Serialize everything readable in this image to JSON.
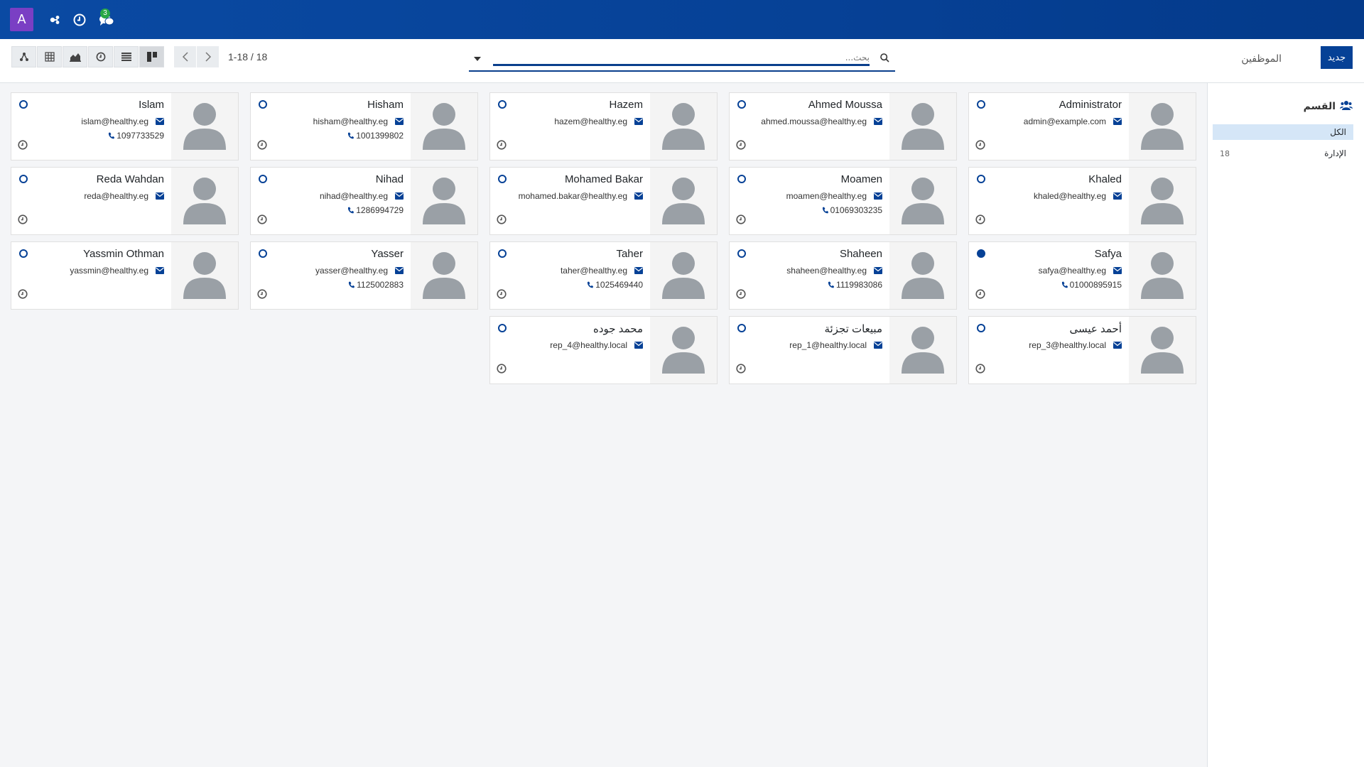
{
  "navbar": {
    "avatar_letter": "A",
    "message_count": "3"
  },
  "control_panel": {
    "breadcrumb": "الموظفين",
    "new_button": "جديد",
    "search_placeholder": "بحث...",
    "pager_value": "1-18 / 18",
    "view_icons": [
      "hierarchy-icon",
      "pivot-icon",
      "graph-icon",
      "activity-icon",
      "list-icon",
      "kanban-icon"
    ]
  },
  "side_panel": {
    "header": "القسم",
    "items": [
      {
        "label": "الكل",
        "count": "",
        "active": true
      },
      {
        "label": "الإدارة",
        "count": "18",
        "active": false
      }
    ]
  },
  "employees": [
    {
      "name": "Administrator",
      "email": "admin@example.com",
      "phone": "",
      "online": false
    },
    {
      "name": "Ahmed Moussa",
      "email": "ahmed.moussa@healthy.eg",
      "phone": "",
      "online": false
    },
    {
      "name": "Hazem",
      "email": "hazem@healthy.eg",
      "phone": "",
      "online": false
    },
    {
      "name": "Hisham",
      "email": "hisham@healthy.eg",
      "phone": "1001399802",
      "online": false
    },
    {
      "name": "Islam",
      "email": "islam@healthy.eg",
      "phone": "1097733529",
      "online": false
    },
    {
      "name": "Khaled",
      "email": "khaled@healthy.eg",
      "phone": "",
      "online": false
    },
    {
      "name": "Moamen",
      "email": "moamen@healthy.eg",
      "phone": "01069303235",
      "online": false
    },
    {
      "name": "Mohamed Bakar",
      "email": "mohamed.bakar@healthy.eg",
      "phone": "",
      "online": false
    },
    {
      "name": "Nihad",
      "email": "nihad@healthy.eg",
      "phone": "1286994729",
      "online": false
    },
    {
      "name": "Reda Wahdan",
      "email": "reda@healthy.eg",
      "phone": "",
      "online": false
    },
    {
      "name": "Safya",
      "email": "safya@healthy.eg",
      "phone": "01000895915",
      "online": true
    },
    {
      "name": "Shaheen",
      "email": "shaheen@healthy.eg",
      "phone": "1119983086",
      "online": false
    },
    {
      "name": "Taher",
      "email": "taher@healthy.eg",
      "phone": "1025469440",
      "online": false
    },
    {
      "name": "Yasser",
      "email": "yasser@healthy.eg",
      "phone": "1125002883",
      "online": false
    },
    {
      "name": "Yassmin Othman",
      "email": "yassmin@healthy.eg",
      "phone": "",
      "online": false
    },
    {
      "name": "أحمد عيسى",
      "email": "rep_3@healthy.local",
      "phone": "",
      "online": false
    },
    {
      "name": "مبيعات تجزئة",
      "email": "rep_1@healthy.local",
      "phone": "",
      "online": false
    },
    {
      "name": "محمد جوده",
      "email": "rep_4@healthy.local",
      "phone": "",
      "online": false
    }
  ]
}
